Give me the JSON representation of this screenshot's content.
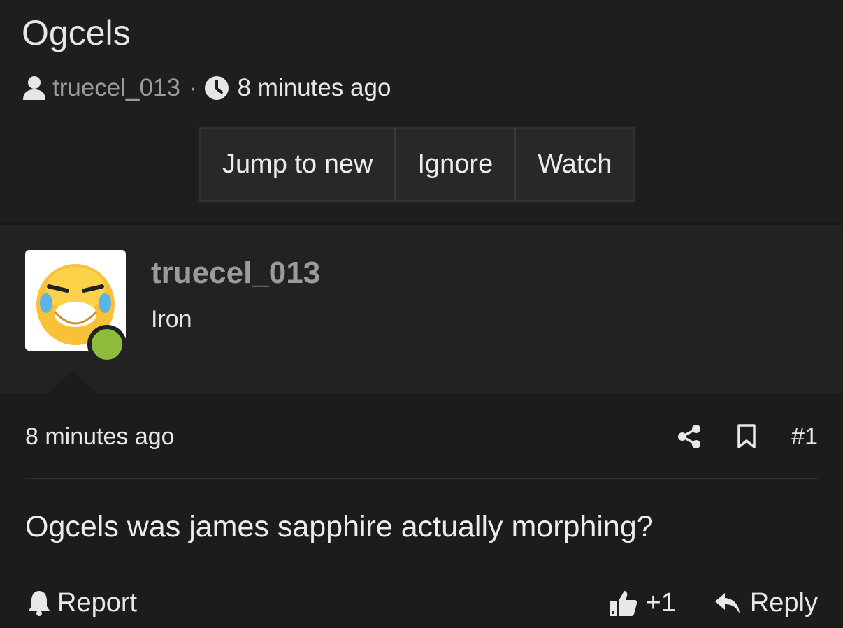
{
  "thread": {
    "title": "Ogcels",
    "author": "truecel_013",
    "separator": "·",
    "time": "8 minutes ago"
  },
  "buttons": {
    "jump_to_new": "Jump to new",
    "ignore": "Ignore",
    "watch": "Watch"
  },
  "post": {
    "user_name": "truecel_013",
    "user_title": "Iron",
    "online": true,
    "date": "8 minutes ago",
    "number": "#1",
    "body": "Ogcels was james sapphire actually morphing?",
    "report_label": "Report",
    "like_count": "+1",
    "reply_label": "Reply"
  },
  "colors": {
    "background": "#1c1c1c",
    "online": "#8dbb3b",
    "muted": "#9a9a9a"
  },
  "icons": [
    "user-icon",
    "clock-icon",
    "share-icon",
    "bookmark-icon",
    "bell-icon",
    "thumbs-up-icon",
    "reply-icon"
  ]
}
